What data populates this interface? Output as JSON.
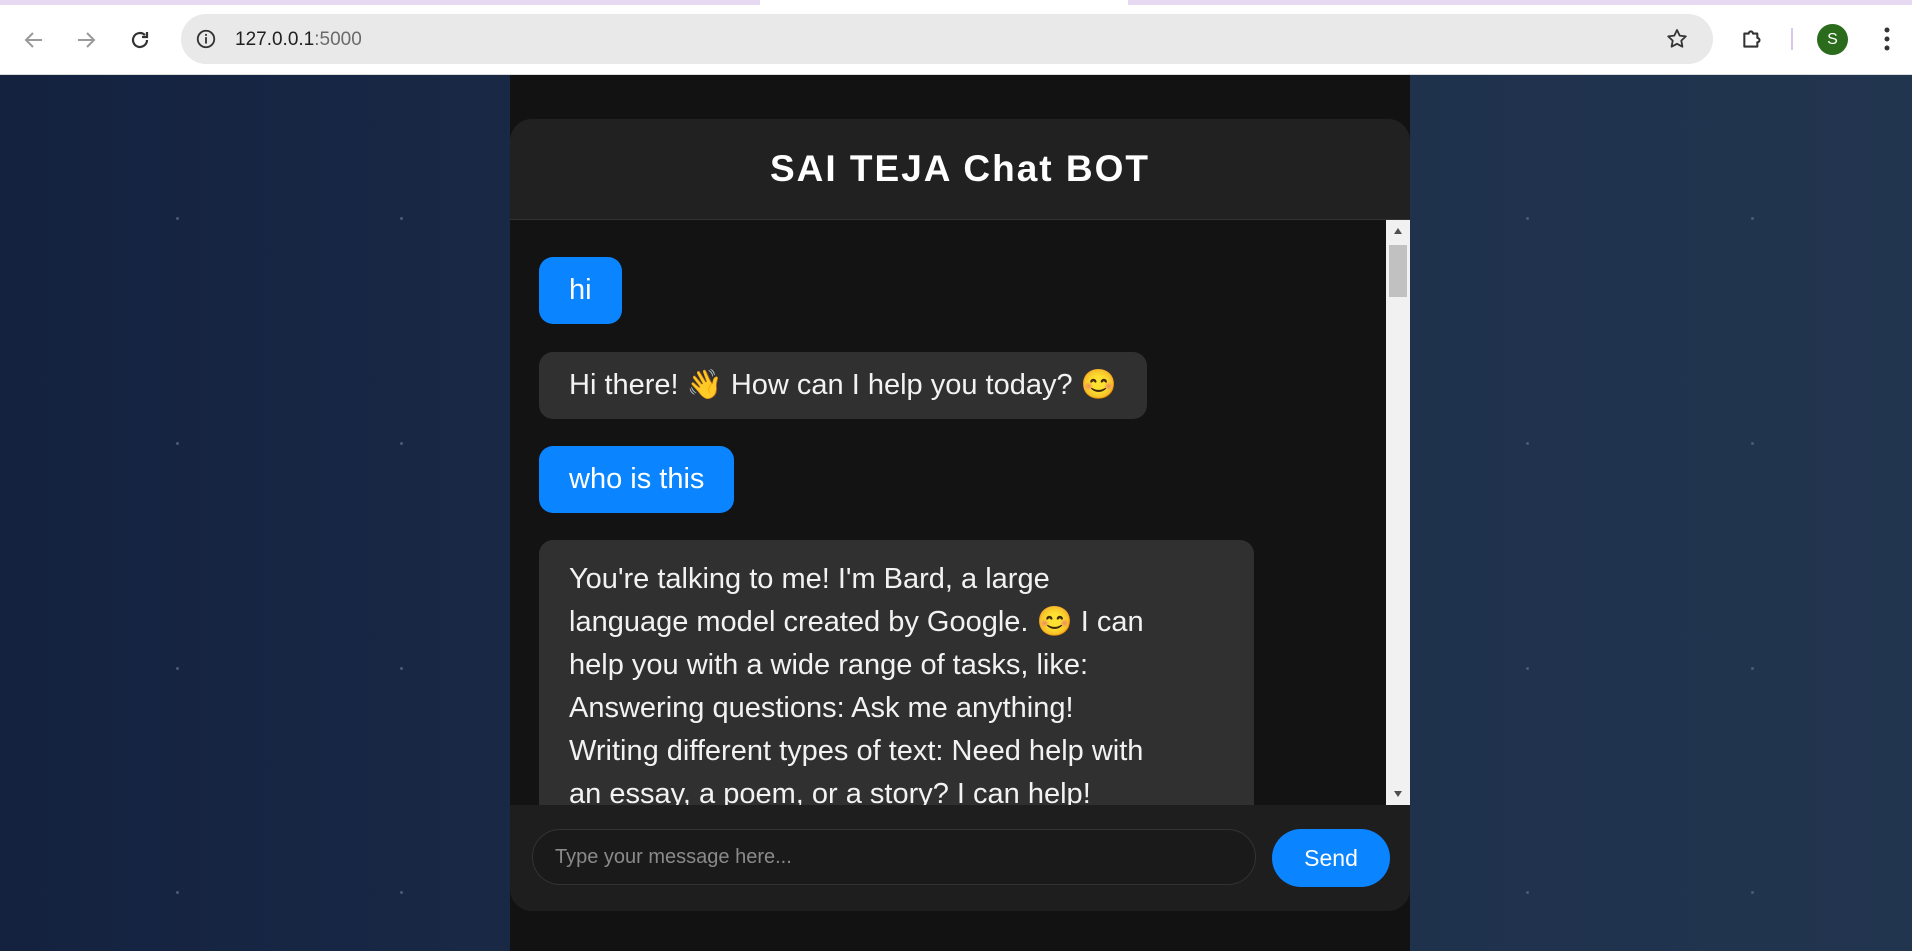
{
  "browser": {
    "url_host": "127.0.0.1",
    "url_port": ":5000",
    "profile_initial": "S",
    "icons": {
      "back": "arrow-left-icon",
      "forward": "arrow-right-icon",
      "reload": "reload-icon",
      "site_info": "info-icon",
      "bookmark": "star-icon",
      "extensions": "puzzle-icon",
      "menu": "kebab-menu-icon"
    }
  },
  "chat": {
    "title": "SAI TEJA Chat BOT",
    "messages": [
      {
        "role": "user",
        "text": "hi"
      },
      {
        "role": "bot",
        "text": "Hi there! 👋 How can I help you today? 😊"
      },
      {
        "role": "user",
        "text": "who is this"
      },
      {
        "role": "bot",
        "lines": [
          "You're talking to me! I'm Bard, a large",
          "language model created by Google. 😊 I can",
          "help you with a wide range of tasks, like:",
          "Answering questions: Ask me anything!",
          "Writing different types of text: Need help with",
          "an essay, a poem, or a story? I can help!"
        ]
      }
    ],
    "input_placeholder": "Type your message here...",
    "input_value": "",
    "send_label": "Send"
  },
  "colors": {
    "user_bubble": "#0a84ff",
    "bot_bubble": "#303030",
    "send_button": "#0a84ff",
    "card_background": "#1e1e1e"
  }
}
